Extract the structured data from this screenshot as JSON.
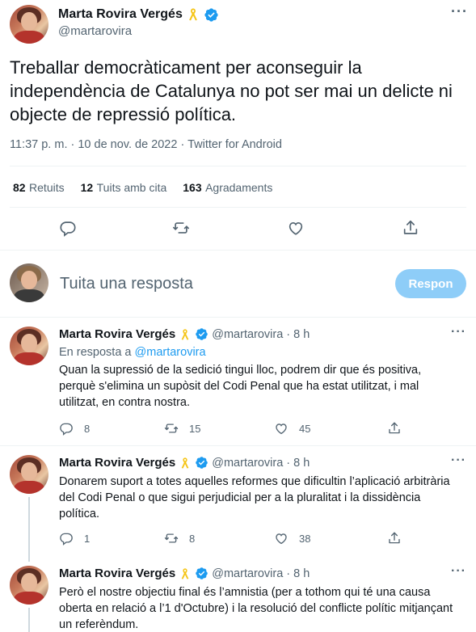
{
  "author": {
    "name": "Marta Rovira Vergés",
    "handle": "@martarovira",
    "ribbon_icon": "yellow-ribbon-icon",
    "verified_icon": "verified-badge-icon"
  },
  "main_tweet": {
    "text": "Treballar democràticament per aconseguir la independència de Catalunya no pot ser mai un delicte ni objecte de repressió política.",
    "timestamp": "11:37 p. m. · 10 de nov. de 2022 · Twitter for Android",
    "stats": {
      "retweets_count": "82",
      "retweets_label": "Retuits",
      "quotes_count": "12",
      "quotes_label": "Tuits amb cita",
      "likes_count": "163",
      "likes_label": "Agradaments"
    }
  },
  "reply_box": {
    "placeholder": "Tuita una resposta",
    "button_label": "Respon"
  },
  "replies": [
    {
      "name": "Marta Rovira Vergés",
      "handle": "@martarovira",
      "time": "· 8 h",
      "reply_to_prefix": "En resposta a",
      "reply_to_handle": "@martarovira",
      "text": "Quan la supressió de la sedició tingui lloc, podrem dir que és positiva, perquè s'elimina un supòsit del Codi Penal que ha estat utilitzat, i mal utilitzat, en contra nostra.",
      "replies": "8",
      "retweets": "15",
      "likes": "45"
    },
    {
      "name": "Marta Rovira Vergés",
      "handle": "@martarovira",
      "time": "· 8 h",
      "text": "Donarem suport a totes aquelles reformes que dificultin l’aplicació arbitrària del Codi Penal o que sigui perjudicial per a la pluralitat i la dissidència política.",
      "replies": "1",
      "retweets": "8",
      "likes": "38"
    },
    {
      "name": "Marta Rovira Vergés",
      "handle": "@martarovira",
      "time": "· 8 h",
      "text": "Però el nostre objectiu final és l’amnistia (per a tothom qui té una causa oberta en relació a l’1 d'Octubre) i la resolució del conflicte polític mitjançant un referèndum."
    }
  ],
  "colors": {
    "accent": "#1d9bf0",
    "accent_disabled": "#8ecdf8",
    "muted": "#536471",
    "ribbon": "#f5c518"
  }
}
